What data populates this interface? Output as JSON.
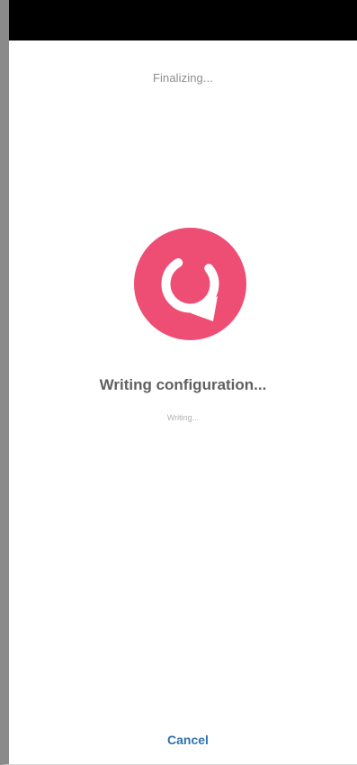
{
  "header": {
    "title": "Finalizing..."
  },
  "progress": {
    "icon": "refresh-arrow-icon",
    "title": "Writing configuration...",
    "status": "Writing..."
  },
  "actions": {
    "cancel_label": "Cancel"
  },
  "colors": {
    "accent": "#ee4d74",
    "link": "#2f73ad",
    "status_bar": "#000000"
  }
}
